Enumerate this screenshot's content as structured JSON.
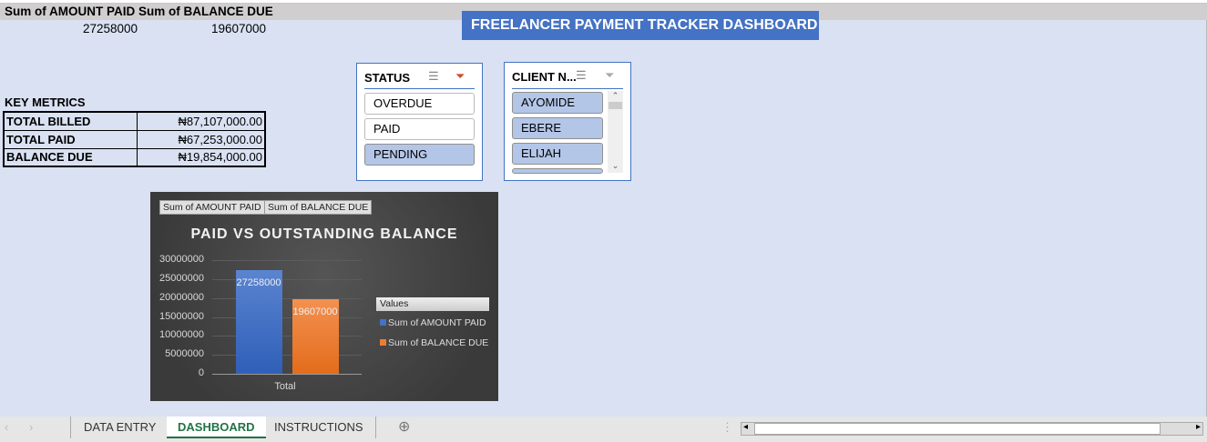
{
  "pivot": {
    "headers": [
      "Sum of AMOUNT PAID",
      "Sum of BALANCE DUE"
    ],
    "values": [
      "27258000",
      "19607000"
    ]
  },
  "dashboard_title": "FREELANCER PAYMENT TRACKER DASHBOARD",
  "key_metrics": {
    "label": "KEY METRICS",
    "rows": [
      {
        "label": "TOTAL BILLED",
        "value": "₦87,107,000.00"
      },
      {
        "label": "TOTAL PAID",
        "value": "₦67,253,000.00"
      },
      {
        "label": "BALANCE DUE",
        "value": "₦19,854,000.00"
      }
    ]
  },
  "status_slicer": {
    "title": "STATUS",
    "items": [
      {
        "label": "OVERDUE",
        "selected": false
      },
      {
        "label": "PAID",
        "selected": false
      },
      {
        "label": "PENDING",
        "selected": true
      }
    ]
  },
  "client_slicer": {
    "title": "CLIENT N...",
    "items": [
      {
        "label": "AYOMIDE",
        "selected": true
      },
      {
        "label": "EBERE",
        "selected": true
      },
      {
        "label": "ELIJAH",
        "selected": true
      }
    ]
  },
  "chart_data": {
    "type": "bar",
    "title": "PAID VS OUTSTANDING BALANCE",
    "field_buttons": [
      "Sum of AMOUNT PAID",
      "Sum of BALANCE DUE"
    ],
    "categories": [
      "Total"
    ],
    "series": [
      {
        "name": "Sum of AMOUNT PAID",
        "values": [
          27258000
        ],
        "color": "#4472c4"
      },
      {
        "name": "Sum of BALANCE DUE",
        "values": [
          19607000
        ],
        "color": "#ed7d31"
      }
    ],
    "ylim": [
      0,
      30000000
    ],
    "yticks": [
      "30000000",
      "25000000",
      "20000000",
      "15000000",
      "10000000",
      "5000000",
      "0"
    ],
    "legend_title": "Values",
    "legend_position": "right"
  },
  "tabs": {
    "items": [
      "DATA ENTRY",
      "DASHBOARD",
      "INSTRUCTIONS"
    ],
    "active": "DASHBOARD"
  }
}
